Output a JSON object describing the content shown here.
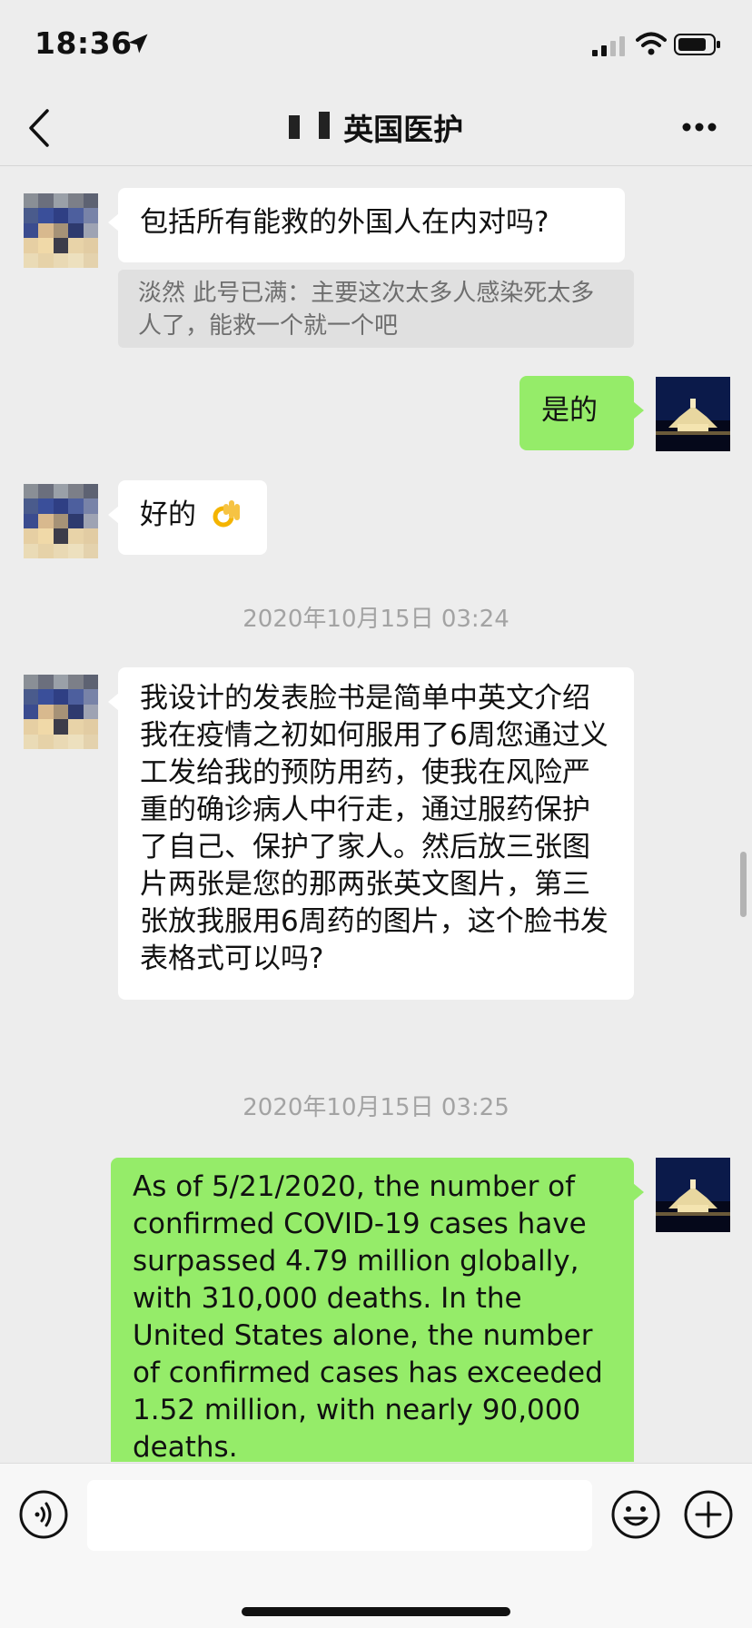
{
  "status_bar": {
    "time": "18:36"
  },
  "nav": {
    "title": "英国医护"
  },
  "messages": [
    {
      "direction": "in",
      "text": "包括所有能救的外国人在内对吗?",
      "quote": "淡然 此号已满：主要这次太多人感染死太多人了，能救一个就一个吧"
    },
    {
      "direction": "out",
      "text": "是的"
    },
    {
      "direction": "in",
      "text": "好的",
      "emoji": "ok-hand-emoji"
    },
    {
      "type": "timestamp",
      "text": "2020年10月15日 03:24"
    },
    {
      "direction": "in",
      "text": "我设计的发表脸书是简单中英文介绍我在疫情之初如何服用了6周您通过义工发给我的预防用药，使我在风险严重的确诊病人中行走，通过服药保护了自己、保护了家人。然后放三张图片两张是您的那两张英文图片，第三张放我服用6周药的图片，这个脸书发表格式可以吗?"
    },
    {
      "type": "timestamp",
      "text": "2020年10月15日 03:25"
    },
    {
      "direction": "out",
      "text": "As of 5/21/2020, the number of confirmed COVID-19 cases have surpassed 4.79 million globally, with 310,000 deaths. In the United States alone, the number of confirmed cases has exceeded 1.52 million, with nearly 90,000 deaths."
    }
  ],
  "icons": {
    "back": "chevron-left-icon",
    "more": "more-icon",
    "voice": "voice-icon",
    "emoji": "smiley-icon",
    "add": "plus-circle-icon"
  },
  "colors": {
    "background": "#ededed",
    "incoming_bubble": "#ffffff",
    "outgoing_bubble": "#95ec69",
    "timestamp_text": "#a3a3a3"
  }
}
